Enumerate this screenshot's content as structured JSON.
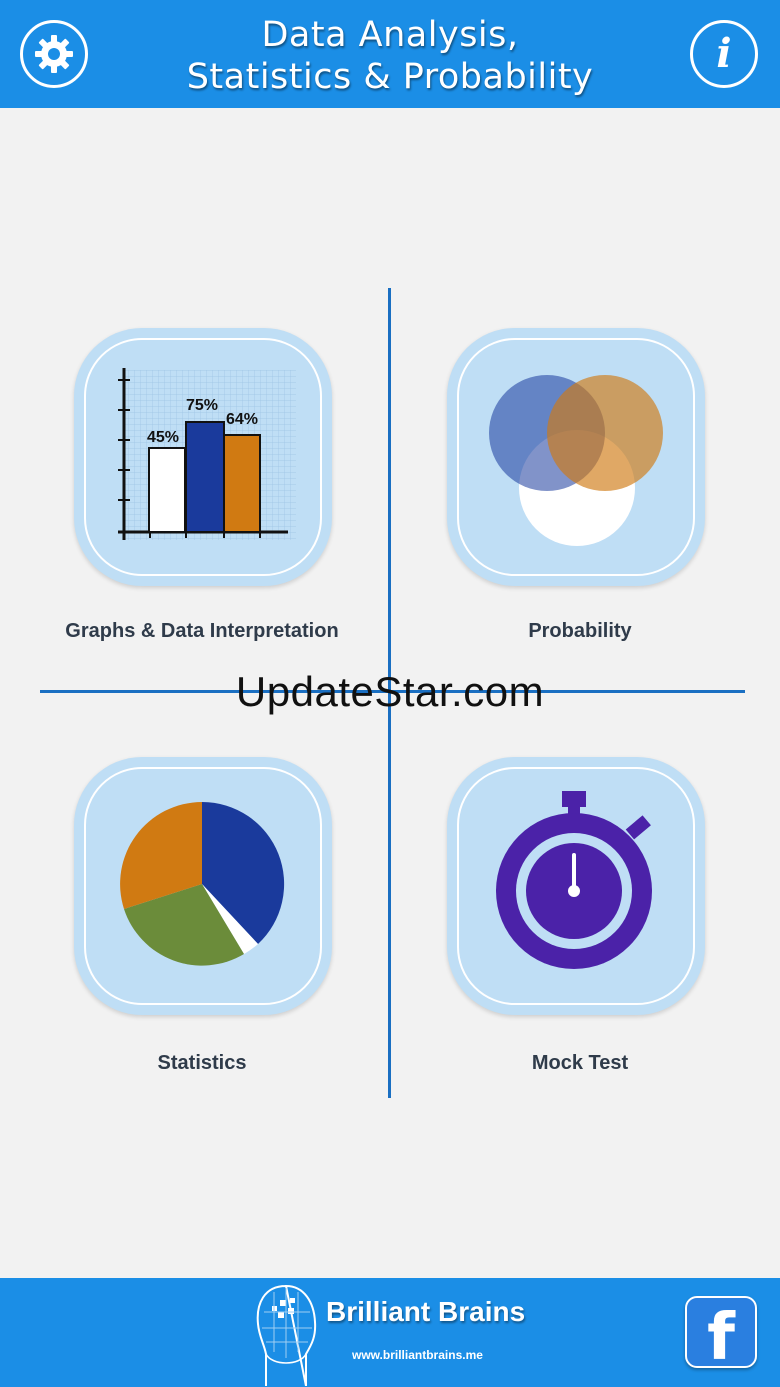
{
  "header": {
    "title_line1": "Data Analysis,",
    "title_line2": "Statistics & Probability",
    "settings_icon": "gear-icon",
    "info_icon": "info-icon",
    "info_glyph": "i"
  },
  "menu": {
    "graphs": {
      "label": "Graphs & Data Interpretation",
      "bars": [
        {
          "value_label": "45%",
          "color": "#ffffff"
        },
        {
          "value_label": "75%",
          "color": "#1a3a9c"
        },
        {
          "value_label": "64%",
          "color": "#d07a12"
        }
      ]
    },
    "probability": {
      "label": "Probability",
      "colors": [
        "#1a3a9c",
        "#d07a12",
        "#ffffff"
      ]
    },
    "statistics": {
      "label": "Statistics",
      "slice_colors": [
        "#1a3a9c",
        "#ffffff",
        "#6b8c3a",
        "#d07a12"
      ]
    },
    "mock_test": {
      "label": "Mock Test",
      "color": "#4b22a8"
    }
  },
  "watermark": "UpdateStar.com",
  "footer": {
    "brand_name": "Brilliant Brains",
    "brand_url": "www.brilliantbrains.me",
    "facebook_glyph": "f"
  },
  "colors": {
    "primary": "#1b8ee6",
    "divider": "#1a6fc2",
    "tile_bg": "#bfdef5",
    "background": "#f2f2f2"
  }
}
